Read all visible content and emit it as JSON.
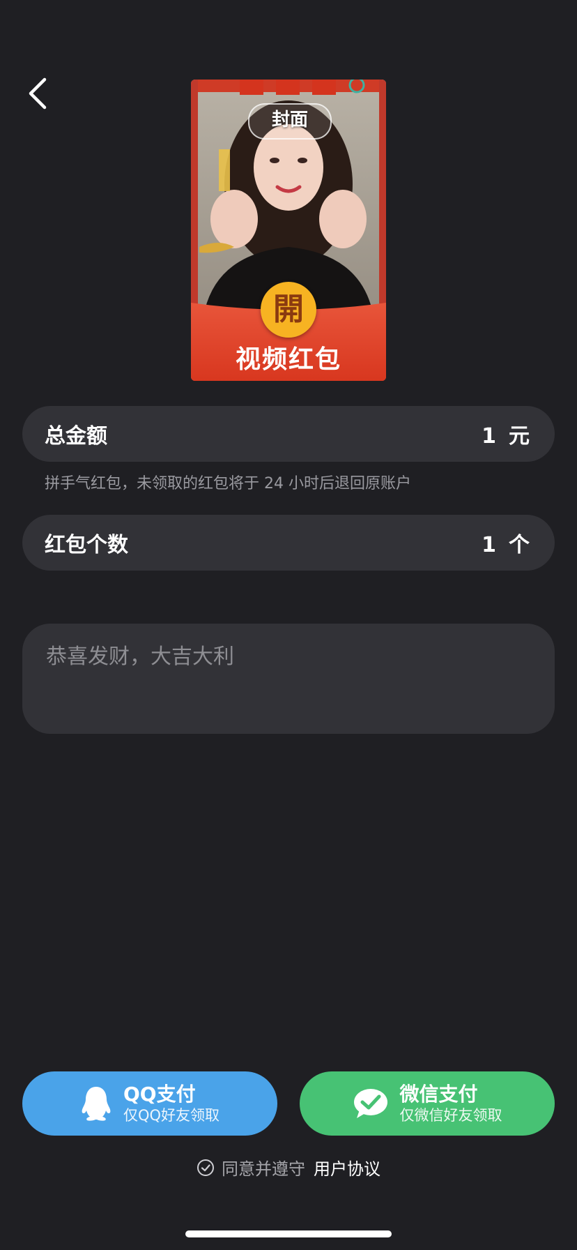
{
  "nav": {
    "back_icon": "chevron-left-icon"
  },
  "cover": {
    "label": "封面",
    "open_badge": "開",
    "title": "视频红包",
    "colors": {
      "envelope_red": "#e84a2e",
      "badge_gold": "#f7b322"
    }
  },
  "amount": {
    "label": "总金额",
    "value": "1",
    "unit": "元"
  },
  "hint": "拼手气红包，未领取的红包将于 24 小时后退回原账户",
  "count": {
    "label": "红包个数",
    "value": "1",
    "unit": "个"
  },
  "greeting": {
    "placeholder": "恭喜发财，大吉大利",
    "value": ""
  },
  "payments": {
    "qq": {
      "title": "QQ支付",
      "subtitle": "仅QQ好友领取",
      "color": "#4aa3e9",
      "icon": "qq-penguin-icon"
    },
    "wechat": {
      "title": "微信支付",
      "subtitle": "仅微信好友领取",
      "color": "#47c274",
      "icon": "wechat-icon"
    }
  },
  "agreement": {
    "text": "同意并遵守",
    "link": "用户协议",
    "icon": "check-circle-icon"
  }
}
